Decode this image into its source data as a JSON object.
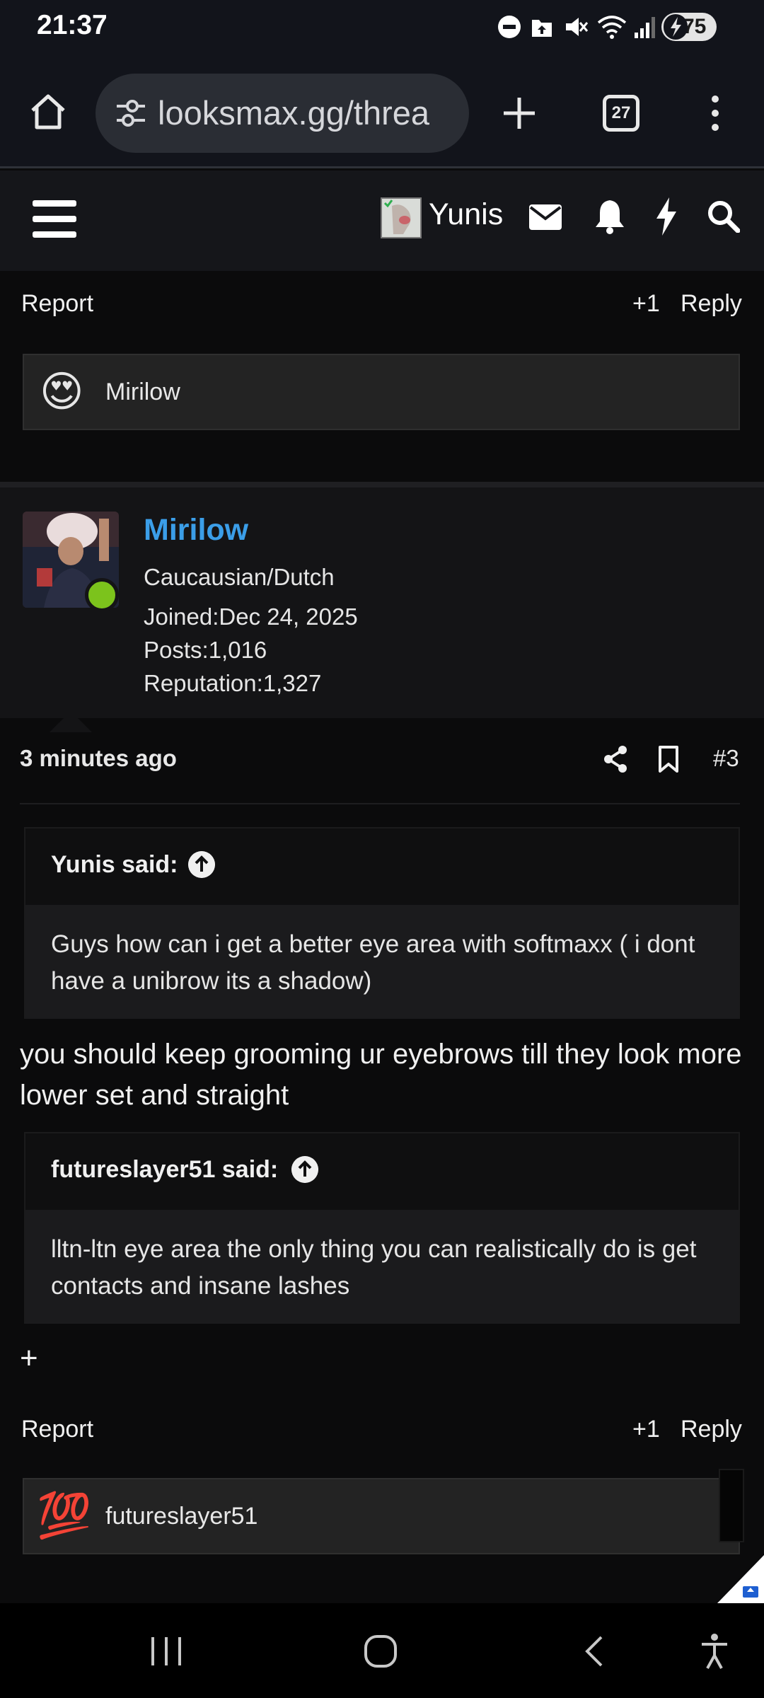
{
  "status_bar": {
    "time": "21:37",
    "battery": "75",
    "icons": [
      "do-not-disturb-icon",
      "upload-icon",
      "mute-icon",
      "wifi-icon",
      "signal-icon",
      "battery-icon"
    ]
  },
  "browser": {
    "url": "looksmax.gg/threa",
    "tab_count": "27"
  },
  "site_header": {
    "username": "Yunis"
  },
  "prev_post": {
    "report_label": "Report",
    "plus_one_label": "+1",
    "reply_label": "Reply",
    "reaction_user": "Mirilow",
    "reaction_emoji": "😍"
  },
  "post": {
    "author": "Mirilow",
    "ethnicity": "Caucausian/Dutch",
    "joined": "Joined:Dec 24, 2025",
    "posts": "Posts:1,016",
    "reputation": "Reputation:1,327",
    "time_ago": "3 minutes ago",
    "number": "#3",
    "quote1_head": "Yunis said:",
    "quote1_body": "Guys how can i get a better eye area with softmaxx ( i dont have a unibrow its a shadow)",
    "reply1": "you should keep grooming ur eyebrows till they look more lower set and straight",
    "quote2_head": "futureslayer51 said:",
    "quote2_body": "lltn-ltn eye area the only thing you can realistically do is get contacts and insane lashes",
    "expand": "+",
    "report_label": "Report",
    "plus_one_label": "+1",
    "reply_label": "Reply",
    "reaction_user": "futureslayer51",
    "reaction_emoji": "💯"
  },
  "colors": {
    "accent_name": "#3b9ee8",
    "online": "#7cc31c"
  }
}
